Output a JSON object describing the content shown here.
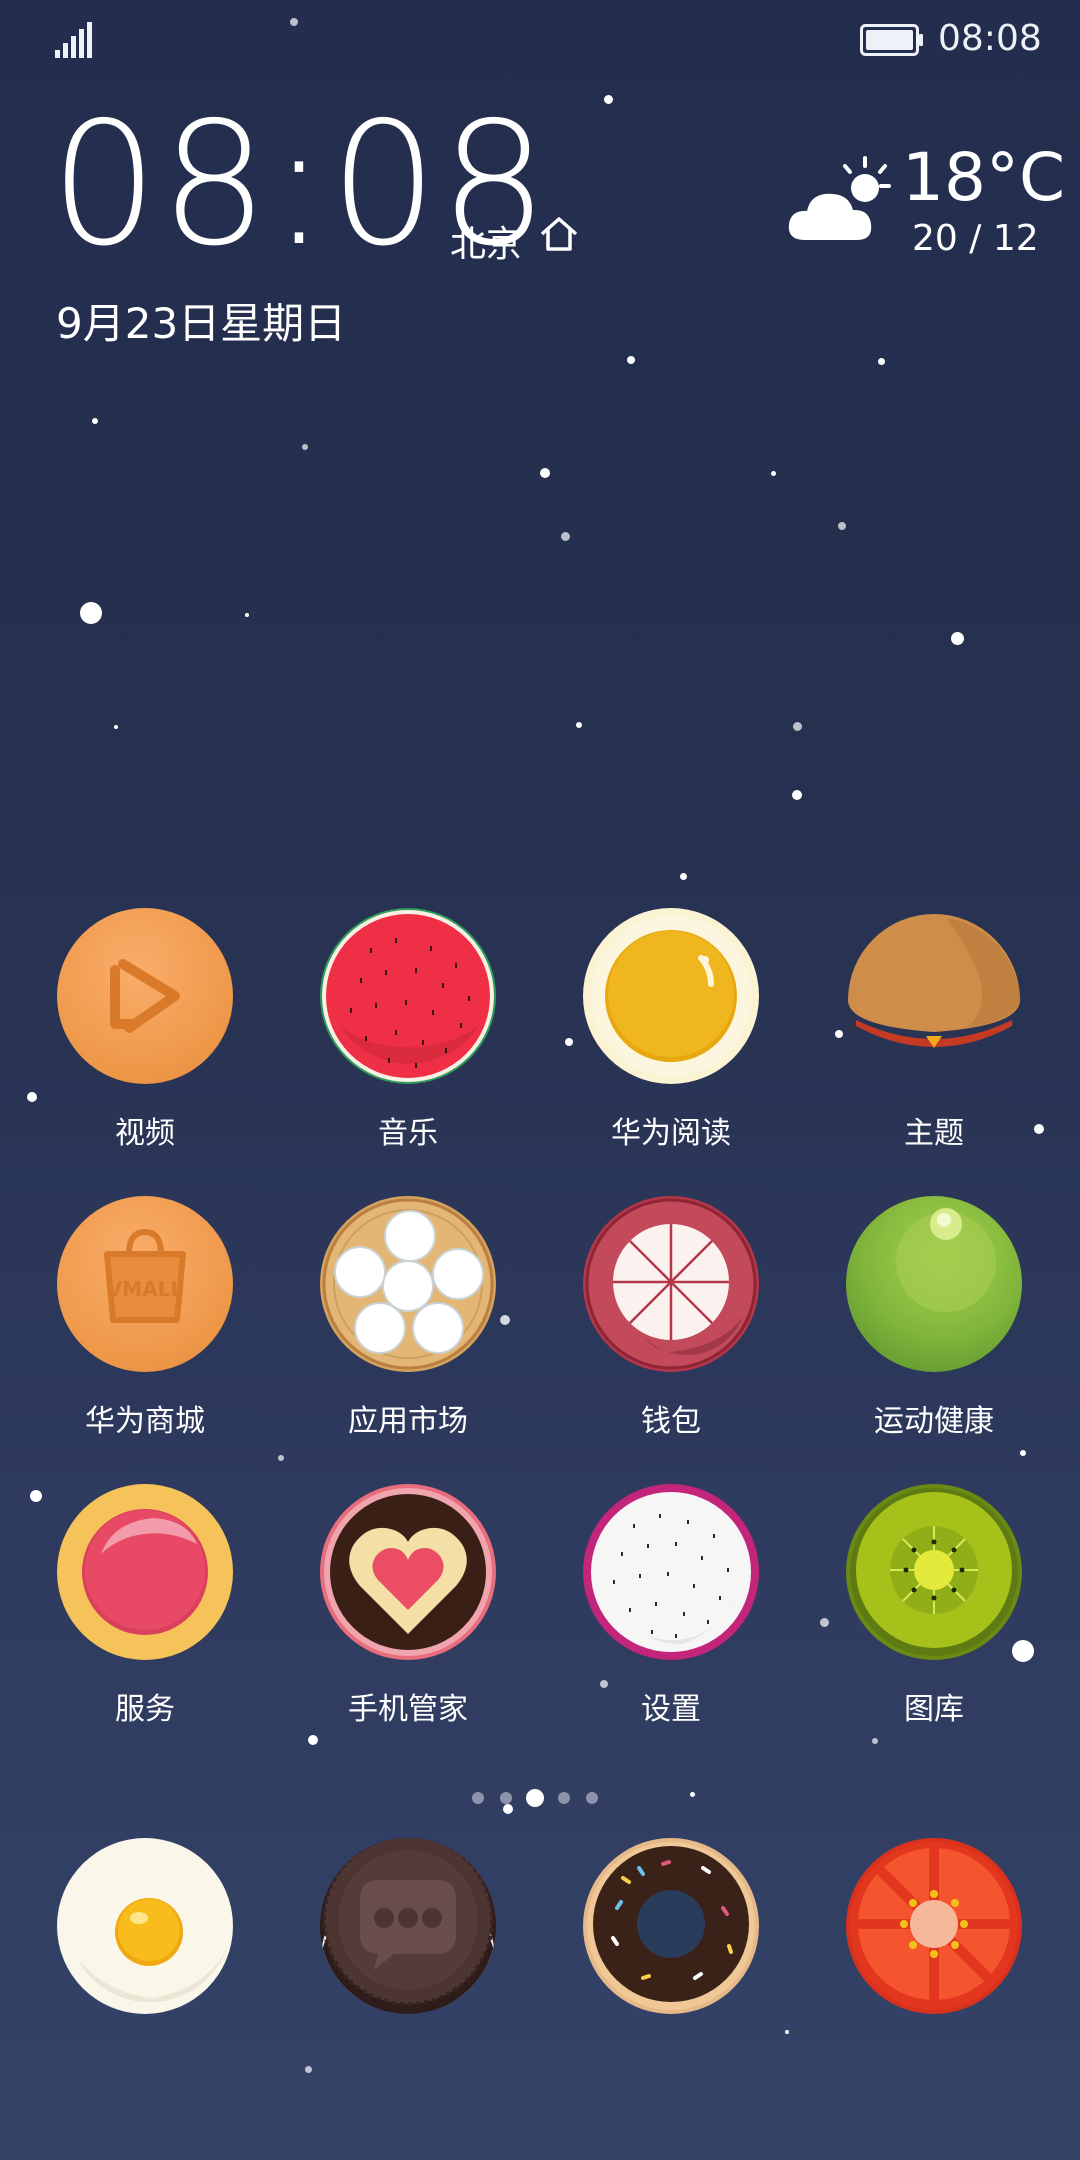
{
  "status_bar": {
    "time": "08:08",
    "icons": [
      "signal-icon",
      "battery-icon"
    ]
  },
  "clock": {
    "time": "08:08",
    "city": "北京",
    "date": "9月23日星期日"
  },
  "weather": {
    "icon": "partly-cloudy-icon",
    "temperature": "18°C",
    "range": "20 / 12"
  },
  "apps": [
    {
      "label": "视频",
      "icon": "video-icon"
    },
    {
      "label": "音乐",
      "icon": "music-icon"
    },
    {
      "label": "华为阅读",
      "icon": "reading-icon"
    },
    {
      "label": "主题",
      "icon": "theme-icon"
    },
    {
      "label": "华为商城",
      "icon": "vmall-icon",
      "icon_text": "VMALL"
    },
    {
      "label": "应用市场",
      "icon": "app-market-icon"
    },
    {
      "label": "钱包",
      "icon": "wallet-icon"
    },
    {
      "label": "运动健康",
      "icon": "health-icon"
    },
    {
      "label": "服务",
      "icon": "services-icon"
    },
    {
      "label": "手机管家",
      "icon": "phone-manager-icon"
    },
    {
      "label": "设置",
      "icon": "settings-icon"
    },
    {
      "label": "图库",
      "icon": "gallery-icon"
    }
  ],
  "dock": [
    {
      "icon": "phone-icon"
    },
    {
      "icon": "messages-icon"
    },
    {
      "icon": "browser-icon"
    },
    {
      "icon": "camera-icon"
    }
  ],
  "pager": {
    "count": 5,
    "active": 2
  }
}
